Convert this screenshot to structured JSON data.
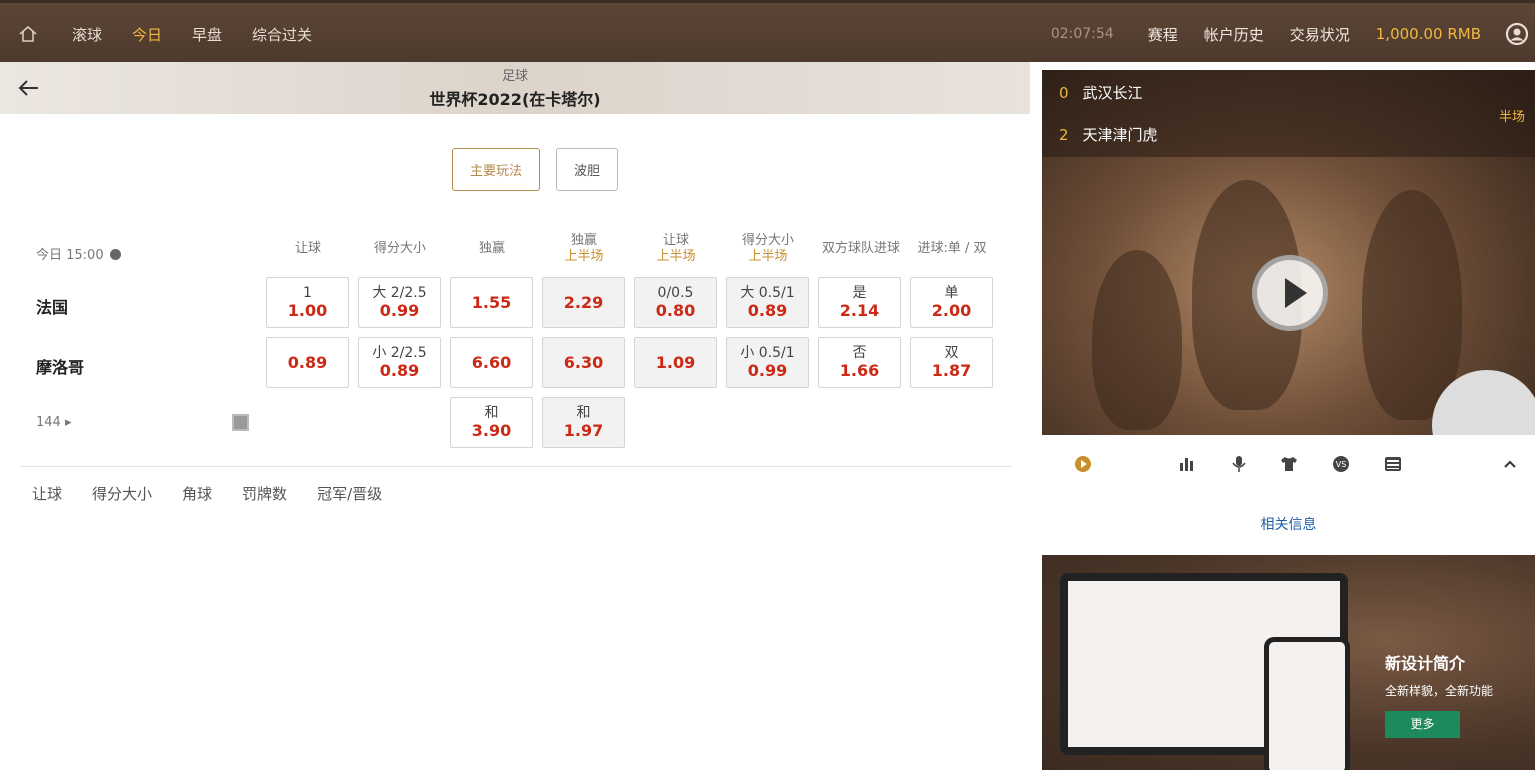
{
  "topbar": {
    "nav": [
      {
        "label": "滚球",
        "active": false
      },
      {
        "label": "今日",
        "active": true
      },
      {
        "label": "早盘",
        "active": false
      },
      {
        "label": "综合过关",
        "active": false
      }
    ],
    "time": "02:07:54",
    "links": [
      "赛程",
      "帐户历史",
      "交易状况"
    ],
    "balance": "1,000.00 RMB"
  },
  "header": {
    "sport": "足球",
    "league": "世界杯2022(在卡塔尔)"
  },
  "toggles": {
    "main": "主要玩法",
    "correct_score": "波胆"
  },
  "match": {
    "kickoff": "今日 15:00",
    "columns": [
      {
        "label": "让球",
        "sub": ""
      },
      {
        "label": "得分大小",
        "sub": ""
      },
      {
        "label": "独赢",
        "sub": ""
      },
      {
        "label": "独赢",
        "sub": "上半场"
      },
      {
        "label": "让球",
        "sub": "上半场"
      },
      {
        "label": "得分大小",
        "sub": "上半场"
      },
      {
        "label": "双方球队进球",
        "sub": ""
      },
      {
        "label": "进球:单 / 双",
        "sub": ""
      }
    ],
    "home": {
      "name": "法国",
      "cells": [
        {
          "lbl": "1",
          "odd": "1.00"
        },
        {
          "lbl": "大 2/2.5",
          "odd": "0.99"
        },
        {
          "lbl": "",
          "odd": "1.55"
        },
        {
          "lbl": "",
          "odd": "2.29"
        },
        {
          "lbl": "0/0.5",
          "odd": "0.80"
        },
        {
          "lbl": "大 0.5/1",
          "odd": "0.89"
        },
        {
          "lbl": "是",
          "odd": "2.14"
        },
        {
          "lbl": "单",
          "odd": "2.00"
        }
      ]
    },
    "away": {
      "name": "摩洛哥",
      "cells": [
        {
          "lbl": "",
          "odd": "0.89"
        },
        {
          "lbl": "小 2/2.5",
          "odd": "0.89"
        },
        {
          "lbl": "",
          "odd": "6.60"
        },
        {
          "lbl": "",
          "odd": "6.30"
        },
        {
          "lbl": "",
          "odd": "1.09"
        },
        {
          "lbl": "小 0.5/1",
          "odd": "0.99"
        },
        {
          "lbl": "否",
          "odd": "1.66"
        },
        {
          "lbl": "双",
          "odd": "1.87"
        }
      ]
    },
    "draw": {
      "cells": [
        {
          "lbl": "和",
          "odd": "3.90"
        },
        {
          "lbl": "和",
          "odd": "1.97"
        }
      ]
    },
    "more_count": "144"
  },
  "tabs": [
    "让球",
    "得分大小",
    "角球",
    "罚牌数",
    "冠军/晋级"
  ],
  "video": {
    "home_score": "0",
    "home_team": "武汉长江",
    "away_score": "2",
    "away_team": "天津津门虎",
    "period": "半场"
  },
  "related": "相关信息",
  "promo": {
    "title": "新设计简介",
    "subtitle": "全新样貌，全新功能",
    "button": "更多"
  },
  "colors": {
    "accent": "#f2b83f",
    "odds": "#cc2a16",
    "topbar": "#4e3a2d",
    "link": "#1e5fa8",
    "promo_button": "#1c8a5a"
  }
}
